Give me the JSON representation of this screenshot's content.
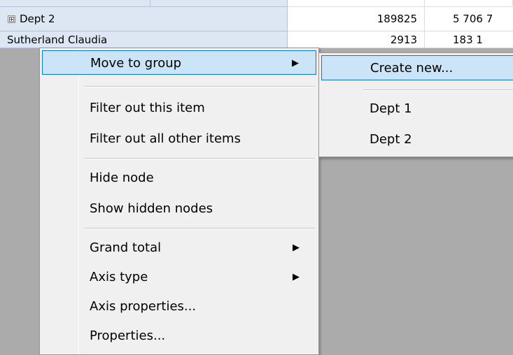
{
  "grid": {
    "rows": [
      {
        "label": "Dept 2",
        "value1": "189825",
        "value2": "5 706 7",
        "expandable": true
      },
      {
        "label": "Sutherland Claudia",
        "value1": "2913",
        "value2": "183 1",
        "expandable": false
      }
    ],
    "toggle_glyph": "⊞"
  },
  "context_menu": {
    "items": [
      {
        "label": "Move to group",
        "submenu": true,
        "highlighted": true
      },
      {
        "label": "Filter out this item"
      },
      {
        "label": "Filter out all other items"
      },
      {
        "label": "Hide node"
      },
      {
        "label": "Show hidden nodes"
      },
      {
        "label": "Grand total",
        "submenu": true
      },
      {
        "label": "Axis type",
        "submenu": true
      },
      {
        "label": "Axis properties..."
      },
      {
        "label": "Properties..."
      }
    ],
    "arrow_glyph": "▶"
  },
  "submenu": {
    "items": [
      {
        "label": "Create new...",
        "highlighted": true
      },
      {
        "label": "Dept 1"
      },
      {
        "label": "Dept 2"
      }
    ]
  },
  "colors": {
    "highlight_bg": "#cce4f7",
    "highlight_border": "#0078d7",
    "menu_bg": "#f0f0f0",
    "header_bg": "#dde7f4"
  }
}
